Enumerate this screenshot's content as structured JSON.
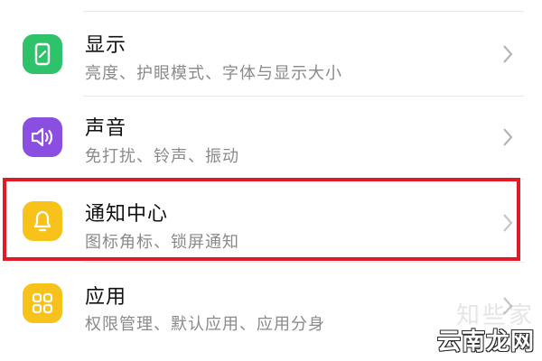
{
  "settings": [
    {
      "title": "显示",
      "subtitle": "亮度、护眼模式、字体与显示大小",
      "icon": "display-phone-icon",
      "icon_color": "#2ec26a"
    },
    {
      "title": "声音",
      "subtitle": "免打扰、铃声、振动",
      "icon": "speaker-icon",
      "icon_color": "#8a4fe0"
    },
    {
      "title": "通知中心",
      "subtitle": "图标角标、锁屏通知",
      "icon": "bell-icon",
      "icon_color": "#f7c31a"
    },
    {
      "title": "应用",
      "subtitle": "权限管理、默认应用、应用分身",
      "icon": "apps-grid-icon",
      "icon_color": "#f7c31a"
    }
  ],
  "highlight": {
    "target": "通知中心",
    "color": "#e01b24"
  },
  "watermark": {
    "faint_text": "知些家",
    "main_text": "云南龙网"
  }
}
